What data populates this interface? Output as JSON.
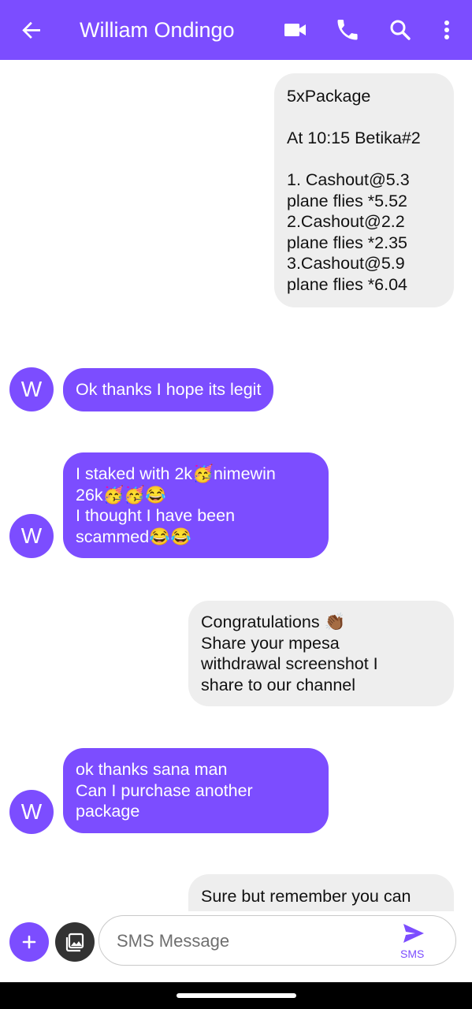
{
  "header": {
    "contact_name": "William Ondingo"
  },
  "messages": [
    {
      "direction": "out",
      "text": "5xPackage\n\nAt 10:15 Betika#2\n\n1. Cashout@5.3\n    plane flies *5.52\n2.Cashout@2.2\n    plane flies *2.35\n3.Cashout@5.9\n    plane flies *6.04"
    },
    {
      "direction": "in",
      "text": "Ok thanks I hope its legit"
    },
    {
      "direction": "in",
      "text": "I staked with 2k🥳nimewin\n26k🥳🥳😂\nI thought I have been\nscammed😂😂"
    },
    {
      "direction": "out",
      "text": "Congratulations 👏🏾\nShare your mpesa\nwithdrawal screenshot I\nshare to our channel"
    },
    {
      "direction": "in",
      "text": "ok thanks sana man\nCan I purchase another\npackage"
    },
    {
      "direction": "out",
      "text": "Sure but remember you can"
    }
  ],
  "avatar_letter": "W",
  "composer": {
    "placeholder": "SMS Message",
    "send_label": "SMS"
  },
  "colors": {
    "accent": "#7c4dff",
    "outgoing_bubble": "#eeeeee"
  },
  "icons": {
    "back": "arrow-back-icon",
    "video": "videocam-icon",
    "call": "phone-icon",
    "search": "search-icon",
    "more": "more-vert-icon",
    "add": "plus-icon",
    "gallery": "gallery-icon",
    "send": "send-icon"
  }
}
